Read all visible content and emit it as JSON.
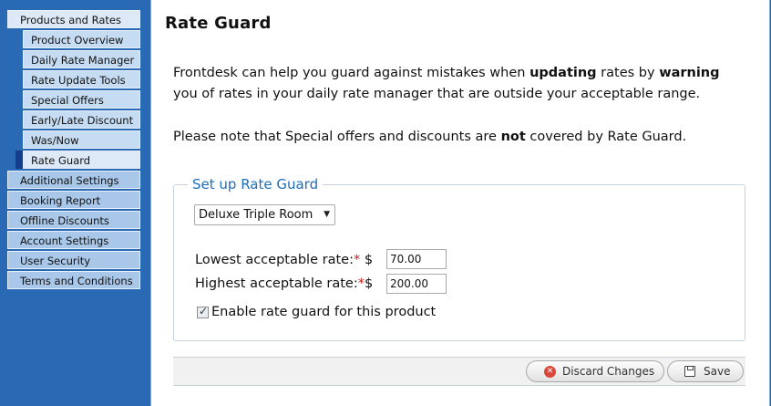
{
  "sidebar": {
    "items": [
      {
        "label": "Products and Rates",
        "level": "top"
      },
      {
        "label": "Product Overview",
        "level": "sub"
      },
      {
        "label": "Daily Rate Manager",
        "level": "sub"
      },
      {
        "label": "Rate Update Tools",
        "level": "sub"
      },
      {
        "label": "Special Offers",
        "level": "sub"
      },
      {
        "label": "Early/Late Discount",
        "level": "sub"
      },
      {
        "label": "Was/Now",
        "level": "sub"
      },
      {
        "label": "Rate Guard",
        "level": "sub",
        "active": true
      },
      {
        "label": "Additional Settings",
        "level": "top"
      },
      {
        "label": "Booking Report",
        "level": "top"
      },
      {
        "label": "Offline Discounts",
        "level": "top"
      },
      {
        "label": "Account Settings",
        "level": "top"
      },
      {
        "label": "User Security",
        "level": "top"
      },
      {
        "label": "Terms and Conditions",
        "level": "top"
      }
    ]
  },
  "main": {
    "title": "Rate Guard",
    "intro": {
      "p1_a": "Frontdesk can help you guard against mistakes when ",
      "p1_b": "updating",
      "p1_c": " rates by ",
      "p1_d": "warning",
      "p1_e": " you of rates in your daily rate manager that are outside your acceptable range.",
      "p2_a": "Please note that Special offers and discounts are ",
      "p2_b": "not",
      "p2_c": " covered by Rate Guard."
    },
    "setup": {
      "legend": "Set up Rate Guard",
      "room_select": "Deluxe Triple Room",
      "lowest_label": "Lowest acceptable rate:",
      "highest_label": "Highest acceptable rate:",
      "required_mark": "*",
      "currency": "$",
      "lowest_value": "70.00",
      "highest_value": "200.00",
      "enable_label": "Enable rate guard for this product",
      "enable_checked": true
    },
    "buttons": {
      "discard": "Discard Changes",
      "save": "Save"
    }
  },
  "colors": {
    "accent": "#1f6db8",
    "sidebar_bg": "#2a6ab5",
    "required": "#d32020"
  }
}
